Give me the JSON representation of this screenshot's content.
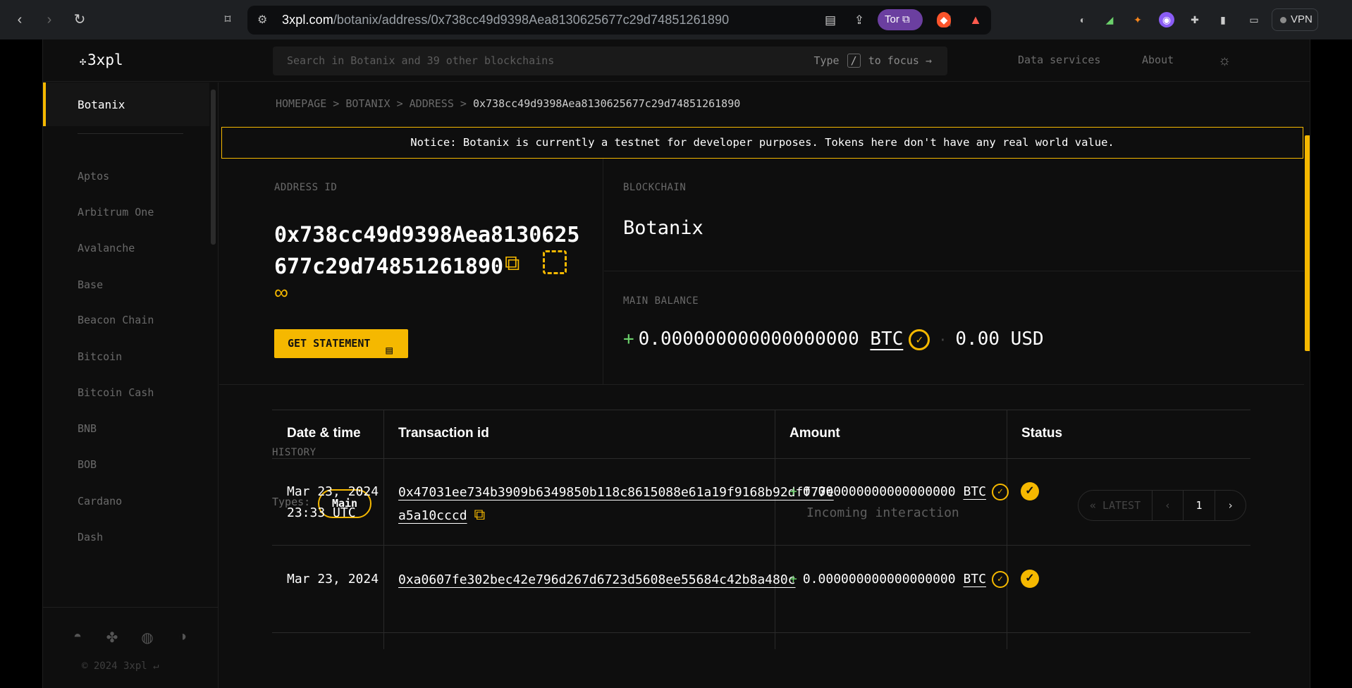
{
  "browser": {
    "url_host": "3xpl.com",
    "url_path": "/botanix/address/0x738cc49d9398Aea8130625677c29d74851261890",
    "tor_label": "Tor",
    "vpn_label": "VPN"
  },
  "header": {
    "logo": "3xpl",
    "search_placeholder": "Search in Botanix and 39 other blockchains",
    "search_hint_pre": "Type",
    "search_hint_key": "/",
    "search_hint_post": "to focus →",
    "nav": [
      "Data services",
      "About"
    ]
  },
  "sidebar": {
    "active": "Botanix",
    "chains": [
      "Aptos",
      "Arbitrum One",
      "Avalanche",
      "Base",
      "Beacon Chain",
      "Bitcoin",
      "Bitcoin Cash",
      "BNB",
      "BOB",
      "Cardano",
      "Dash"
    ],
    "copyright": "© 2024 3xpl ↵"
  },
  "breadcrumb": {
    "home": "HOMEPAGE",
    "chain": "BOTANIX",
    "section": "ADDRESS",
    "current": "0x738cc49d9398Aea8130625677c29d74851261890",
    "sep": ">"
  },
  "notice": "Notice: Botanix is currently a testnet for developer purposes. Tokens here don't have any real world value.",
  "address": {
    "label": "ADDRESS ID",
    "value": "0x738cc49d9398Aea8130625677c29d74851261890",
    "statement_button": "GET STATEMENT"
  },
  "blockchain": {
    "label": "BLOCKCHAIN",
    "value": "Botanix"
  },
  "balance": {
    "label": "MAIN BALANCE",
    "sign": "+",
    "amount": "0.000000000000000000",
    "unit": "BTC",
    "fiat": "0.00 USD"
  },
  "history": {
    "label": "HISTORY",
    "types_label": "Types:",
    "type_active": "Main",
    "pager": {
      "latest": "LATEST",
      "page": "1"
    },
    "columns": [
      "Date & time",
      "Transaction id",
      "Amount",
      "Status"
    ],
    "rows": [
      {
        "date": "Mar 23, 2024",
        "time": "23:33 UTC",
        "tx": "0x47031ee734b3909b6349850b118c8615088e61a19f9168b92dff77ea5a10cccd",
        "sign": "+",
        "amount": "0.000000000000000000",
        "unit": "BTC",
        "note": "Incoming interaction"
      },
      {
        "date": "Mar 23, 2024",
        "time": "",
        "tx": "0xa0607fe302bec42e796d267d6723d5608ee55684c42b8a480c",
        "sign": "+",
        "amount": "0.000000000000000000",
        "unit": "BTC",
        "note": ""
      }
    ]
  },
  "colors": {
    "accent": "#f5b800",
    "positive": "#6bd16b",
    "background": "#0e0e0e"
  }
}
